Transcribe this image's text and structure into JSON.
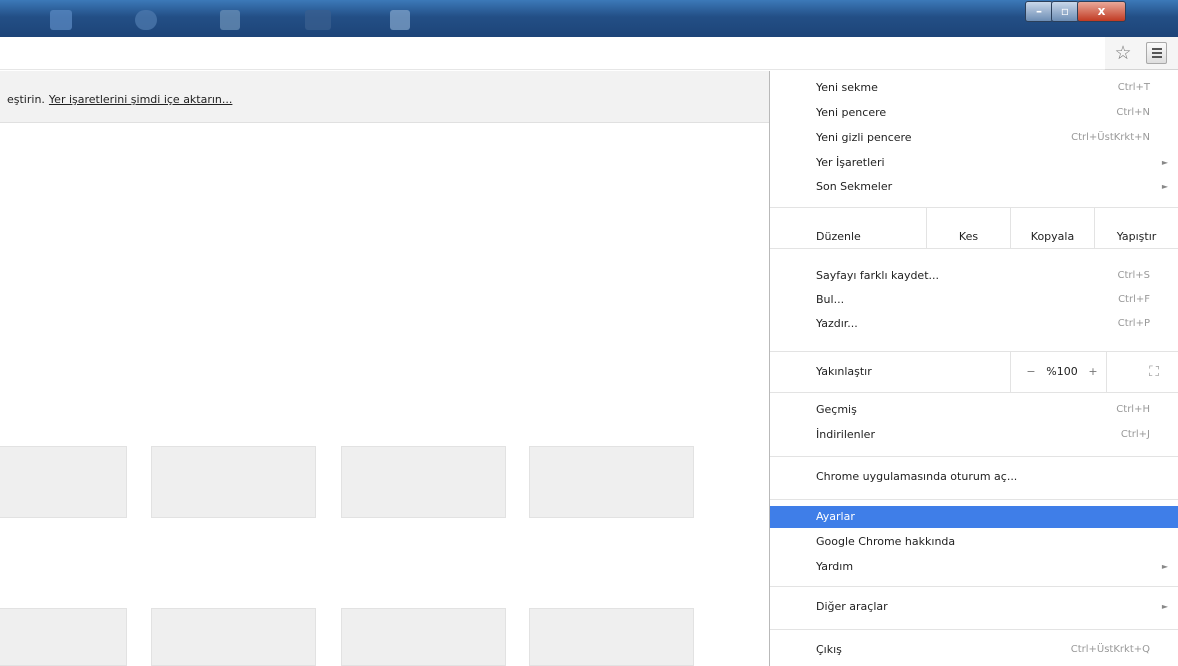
{
  "window": {
    "controls": {
      "minimize": "–",
      "maximize": "▫",
      "close": "x"
    }
  },
  "toolbar": {
    "star_icon": "star-icon",
    "menu_icon": "hamburger-icon"
  },
  "bookmarks_bar": {
    "text": "eştirin.",
    "link": "Yer işaretlerini şimdi içe aktarın..."
  },
  "menu": {
    "new_tab": {
      "label": "Yeni sekme",
      "shortcut": "Ctrl+T"
    },
    "new_window": {
      "label": "Yeni pencere",
      "shortcut": "Ctrl+N"
    },
    "incognito": {
      "label": "Yeni gizli pencere",
      "shortcut": "Ctrl+ÜstKrkt+N"
    },
    "bookmarks": {
      "label": "Yer İşaretleri",
      "arrow": "►"
    },
    "recent_tabs": {
      "label": "Son Sekmeler",
      "arrow": "►"
    },
    "edit": {
      "label": "Düzenle",
      "cut": "Kes",
      "copy": "Kopyala",
      "paste": "Yapıştır"
    },
    "save_page": {
      "label": "Sayfayı farklı kaydet...",
      "shortcut": "Ctrl+S"
    },
    "find": {
      "label": "Bul...",
      "shortcut": "Ctrl+F"
    },
    "print": {
      "label": "Yazdır...",
      "shortcut": "Ctrl+P"
    },
    "zoom": {
      "label": "Yakınlaştır",
      "minus": "−",
      "value": "%100",
      "plus": "+",
      "fullscreen": "⛶"
    },
    "history": {
      "label": "Geçmiş",
      "shortcut": "Ctrl+H"
    },
    "downloads": {
      "label": "İndirilenler",
      "shortcut": "Ctrl+J"
    },
    "signin": {
      "label": "Chrome uygulamasında oturum aç..."
    },
    "settings": {
      "label": "Ayarlar"
    },
    "about": {
      "label": "Google Chrome hakkında"
    },
    "help": {
      "label": "Yardım",
      "arrow": "►"
    },
    "more_tools": {
      "label": "Diğer araçlar",
      "arrow": "►"
    },
    "exit": {
      "label": "Çıkış",
      "shortcut": "Ctrl+ÜstKrkt+Q"
    }
  }
}
